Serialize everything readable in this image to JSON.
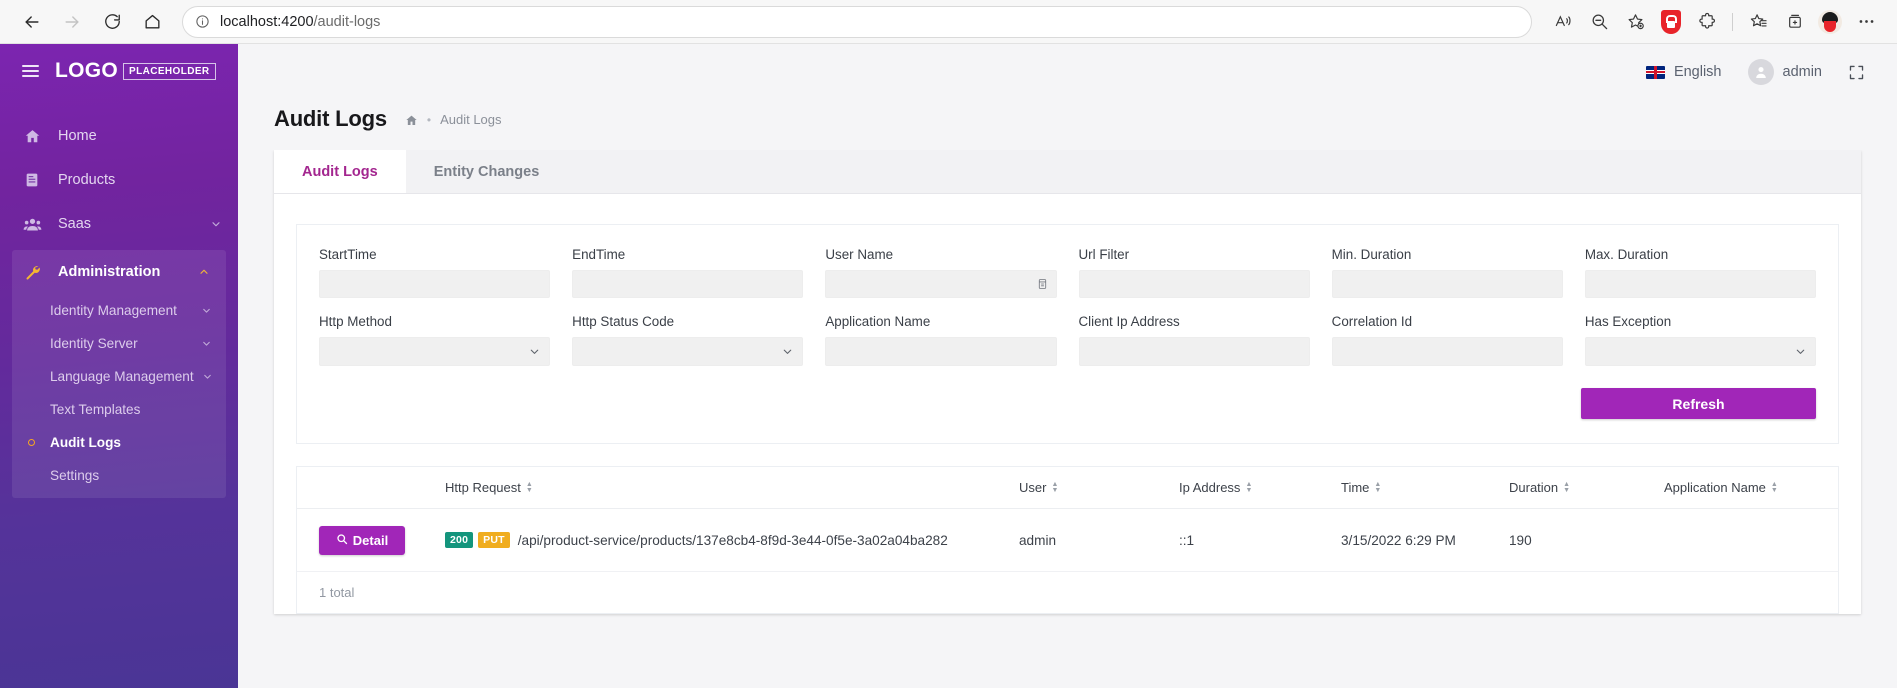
{
  "browser": {
    "url_bold": "localhost:4200",
    "url_dim": "/audit-logs",
    "back_title": "Back",
    "forward_title": "Forward",
    "refresh_title": "Refresh",
    "home_title": "Home",
    "read_aloud_title": "Read aloud",
    "zoom_title": "Zoom",
    "favorite_title": "Add this page to favorites",
    "shield_title": "Security extension",
    "extensions_title": "Extensions",
    "favorites_title": "Favorites",
    "collections_title": "Collections",
    "profile_title": "Profile",
    "settings_title": "Settings and more"
  },
  "sidebar": {
    "logo_main": "LOGO",
    "logo_placeholder": "PLACEHOLDER",
    "items": [
      {
        "label": "Home",
        "icon": "home-icon",
        "caret": false
      },
      {
        "label": "Products",
        "icon": "products-icon",
        "caret": false
      },
      {
        "label": "Saas",
        "icon": "saas-icon",
        "caret": true
      }
    ],
    "group": {
      "label": "Administration",
      "icon": "wrench-icon",
      "expanded": true,
      "children": [
        {
          "label": "Identity Management",
          "caret": true,
          "active": false
        },
        {
          "label": "Identity Server",
          "caret": true,
          "active": false
        },
        {
          "label": "Language Management",
          "caret": true,
          "active": false
        },
        {
          "label": "Text Templates",
          "caret": false,
          "active": false
        },
        {
          "label": "Audit Logs",
          "caret": false,
          "active": true
        },
        {
          "label": "Settings",
          "caret": false,
          "active": false
        }
      ]
    }
  },
  "topbar": {
    "language": "English",
    "user": "admin",
    "fullscreen_title": "Fullscreen"
  },
  "page": {
    "title": "Audit Logs",
    "breadcrumb_home": "home-icon",
    "breadcrumb_sep": "•",
    "breadcrumb_current": "Audit Logs"
  },
  "tabs": [
    {
      "label": "Audit Logs",
      "active": true
    },
    {
      "label": "Entity Changes",
      "active": false
    }
  ],
  "filters": {
    "row1": [
      {
        "label": "StartTime",
        "value": "",
        "type": "text",
        "icon": ""
      },
      {
        "label": "EndTime",
        "value": "",
        "type": "text",
        "icon": ""
      },
      {
        "label": "User Name",
        "value": "",
        "type": "text",
        "icon": "calendar-icon"
      },
      {
        "label": "Url Filter",
        "value": "",
        "type": "text",
        "icon": ""
      },
      {
        "label": "Min. Duration",
        "value": "",
        "type": "text",
        "icon": ""
      },
      {
        "label": "Max. Duration",
        "value": "",
        "type": "text",
        "icon": ""
      }
    ],
    "row2": [
      {
        "label": "Http Method",
        "value": "",
        "type": "select",
        "icon": "chevron-down-icon"
      },
      {
        "label": "Http Status Code",
        "value": "",
        "type": "select",
        "icon": "chevron-down-icon"
      },
      {
        "label": "Application Name",
        "value": "",
        "type": "text",
        "icon": ""
      },
      {
        "label": "Client Ip Address",
        "value": "",
        "type": "text",
        "icon": ""
      },
      {
        "label": "Correlation Id",
        "value": "",
        "type": "text",
        "icon": ""
      },
      {
        "label": "Has Exception",
        "value": "",
        "type": "select",
        "icon": "chevron-down-icon"
      }
    ],
    "refresh_label": "Refresh"
  },
  "table": {
    "columns": [
      {
        "label": "",
        "sortable": false
      },
      {
        "label": "Http Request",
        "sortable": true
      },
      {
        "label": "User",
        "sortable": true
      },
      {
        "label": "Ip Address",
        "sortable": true
      },
      {
        "label": "Time",
        "sortable": true
      },
      {
        "label": "Duration",
        "sortable": true
      },
      {
        "label": "Application Name",
        "sortable": true
      }
    ],
    "rows": [
      {
        "detail_label": "Detail",
        "status_code": "200",
        "http_method": "PUT",
        "url": "/api/product-service/products/137e8cb4-8f9d-3e44-0f5e-3a02a04ba282",
        "user": "admin",
        "ip_address": "::1",
        "time": "3/15/2022 6:29 PM",
        "duration": "190",
        "application_name": ""
      }
    ],
    "footer_total": "1 total"
  },
  "colors": {
    "brand_purple": "#a126b8",
    "sidebar_top": "#7c25b0",
    "sidebar_bottom": "#4a3595",
    "tab_active": "#a3268f",
    "badge_status": "#14957d",
    "badge_method": "#f0ad1f",
    "active_dot": "#f5a623"
  }
}
